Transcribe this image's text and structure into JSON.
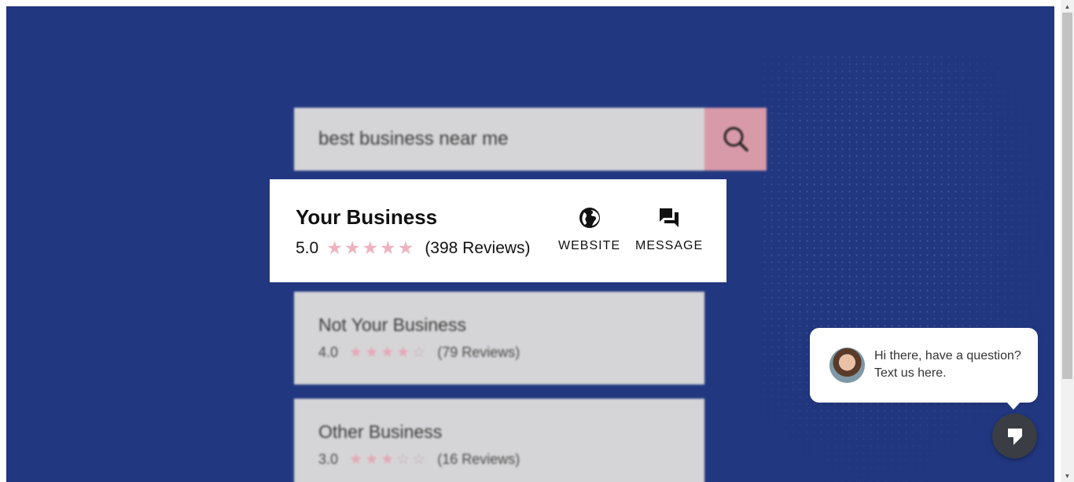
{
  "search": {
    "query": "best business near me"
  },
  "featured": {
    "name": "Your Business",
    "rating": "5.0",
    "stars": "★★★★★",
    "reviews": "(398 Reviews)",
    "website_label": "WEBSITE",
    "message_label": "MESSAGE"
  },
  "results": [
    {
      "name": "Not Your Business",
      "rating": "4.0",
      "stars_on": "★★★★",
      "stars_off": "☆",
      "reviews": "(79 Reviews)"
    },
    {
      "name": "Other Business",
      "rating": "3.0",
      "stars_on": "★★★",
      "stars_off": "☆☆",
      "reviews": "(16 Reviews)"
    }
  ],
  "chat": {
    "message": "Hi there, have a question? Text us here."
  },
  "icons": {
    "search": "search-icon",
    "website": "globe-icon",
    "message": "chat-bubbles-icon",
    "launcher": "chat-icon"
  },
  "colors": {
    "background": "#213780",
    "search_button": "#d89aa8",
    "star_pink": "#eeb3c0",
    "launcher": "#3a3d44"
  }
}
